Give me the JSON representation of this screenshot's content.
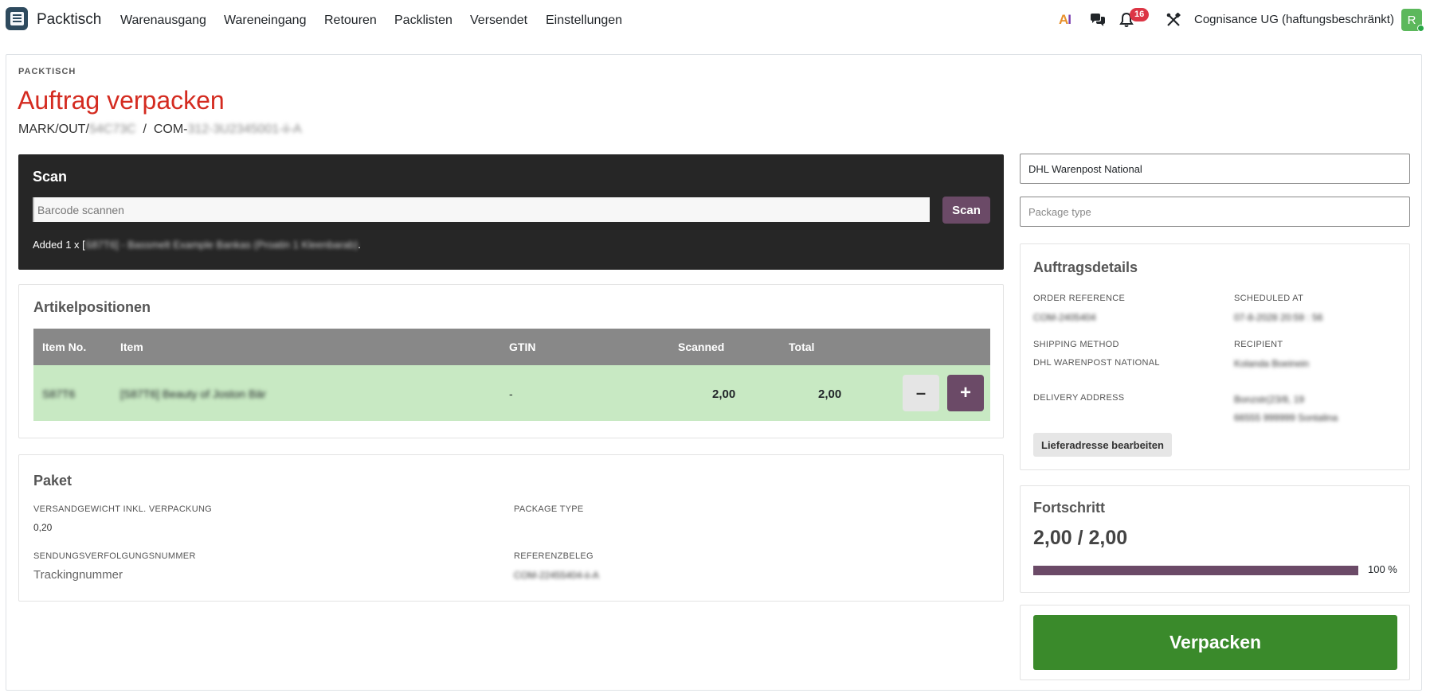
{
  "nav": {
    "brand": "Packtisch",
    "items": [
      "Warenausgang",
      "Wareneingang",
      "Retouren",
      "Packlisten",
      "Versendet",
      "Einstellungen"
    ],
    "ai_label_a": "A",
    "ai_label_i": "I",
    "notifications_count": "16",
    "company": "Cognisance UG (haftungsbeschränkt)",
    "avatar_initial": "R"
  },
  "page": {
    "breadcrumb": "PACKTISCH",
    "title": "Auftrag verpacken",
    "ref_prefix_1": "MARK/OUT/",
    "ref_blur_1": "54C73C",
    "ref_separator": "/",
    "ref_prefix_2": "COM-",
    "ref_blur_2": "312-3U2345001-ii-A"
  },
  "scan": {
    "title": "Scan",
    "input_placeholder": "Barcode scannen",
    "button_label": "Scan",
    "message_prefix": "Added 1 x [",
    "message_blur_code": "S87T6]",
    "message_blur_name": " - Bassmelt Example Bankas (Proatin 1 Kleenbarab)",
    "message_suffix": "."
  },
  "positions": {
    "title": "Artikelpositionen",
    "columns": [
      "Item No.",
      "Item",
      "GTIN",
      "Scanned",
      "Total"
    ],
    "rows": [
      {
        "item_no": "S87T6",
        "item": "[S87T6] Beauty of Joston Bär",
        "gtin": "-",
        "scanned": "2,00",
        "total": "2,00"
      }
    ],
    "minus_label": "–",
    "plus_label": "+"
  },
  "paket": {
    "title": "Paket",
    "weight_label": "VERSANDGEWICHT INKL. VERPACKUNG",
    "weight_value": "0,20",
    "package_type_label": "PACKAGE TYPE",
    "tracking_label": "SENDUNGSVERFOLGUNGSNUMMER",
    "tracking_value": "Trackingnummer",
    "referenz_label": "REFERENZBELEG",
    "referenz_value": "COM-22455404-ii-A"
  },
  "right": {
    "carrier": "DHL Warenpost National",
    "package_type_placeholder": "Package type"
  },
  "details": {
    "title": "Auftragsdetails",
    "order_ref_label": "ORDER REFERENCE",
    "order_ref_value": "COM-2405404",
    "scheduled_label": "SCHEDULED AT",
    "scheduled_value": "07-8-2028 20:59 : 56",
    "shipping_label": "SHIPPING METHOD",
    "shipping_value": "DHL WARENPOST NATIONAL",
    "recipient_label": "RECIPIENT",
    "recipient_value": "Kolanda Boeinein",
    "address_label": "DELIVERY ADDRESS",
    "address_line1": "Bonzstr(23/8, 19",
    "address_line2": "66555 999999 Sontalina",
    "edit_button": "Lieferadresse bearbeiten"
  },
  "progress": {
    "title": "Fortschritt",
    "value_text": "2,00 / 2,00",
    "fraction": 1.0,
    "percent_text": "100 %"
  },
  "actions": {
    "pack_button": "Verpacken"
  }
}
